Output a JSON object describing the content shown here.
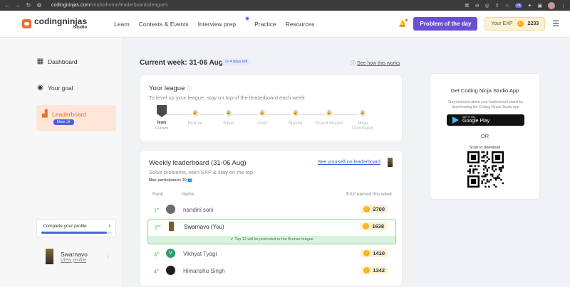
{
  "browser": {
    "url_domain": "codingninjas.com",
    "url_path": "/studio/home/leaderboards/leagues",
    "ext_badge": "28"
  },
  "brand": {
    "name": "codingninjas",
    "sub": "/studio"
  },
  "nav": {
    "items": [
      "Learn",
      "Contests & Events",
      "Interview prep",
      "Practice",
      "Resources"
    ],
    "problem_of_day": "Problem of the day",
    "exp_label": "Your EXP",
    "exp_value": "2233"
  },
  "sidebar": {
    "items": [
      {
        "label": "Dashboard",
        "icon": "dashboard-icon"
      },
      {
        "label": "Your goal",
        "icon": "target-icon"
      }
    ],
    "active": {
      "label": "Leaderboard",
      "badge": "New ✨",
      "icon": "leaderboard-icon"
    },
    "complete_profile": "Complete your profile",
    "complete_progress": 0.92,
    "user_name": "Swarnavo",
    "view_profile": "View profile"
  },
  "main": {
    "current_week": "Current week: 31-06 Aug",
    "days_left": "4 days left",
    "how_it_works": "See how this works",
    "league": {
      "title": "Your league",
      "subtitle": "To level up your league, stay on top of the leaderboard each week",
      "tiers": [
        "Iron",
        "Bronze",
        "Silver",
        "Gold",
        "Master",
        "Grand Master",
        "Ninja Dominator"
      ],
      "current_tier_note": "Current"
    },
    "weekly": {
      "title": "Weekly leaderboard (31-06 Aug)",
      "subtitle": "Solve problems, earn EXP & stay on the top.",
      "max_participants": "Max participants: 30",
      "see_yourself": "See yourself on leaderboard",
      "col_rank": "Rank",
      "col_name": "Name",
      "col_exp": "EXP earned this week",
      "promo_note": "Top 12 will be promoted to the Bronze league",
      "rows": [
        {
          "rank": "1",
          "suffix": "st",
          "name": "nandini soni",
          "exp": "2700",
          "avatar": "",
          "avatar_color": "#6b6b6b"
        },
        {
          "rank": "2",
          "suffix": "nd",
          "name": "Swarnavo (You)",
          "exp": "1638",
          "avatar": "",
          "avatar_color": "#7a5a2a"
        },
        {
          "rank": "3",
          "suffix": "rd",
          "name": "Vikhyat Tyagi",
          "exp": "1410",
          "avatar": "V",
          "avatar_color": "#2e9d6b"
        },
        {
          "rank": "4",
          "suffix": "th",
          "name": "Himanshu Singh",
          "exp": "1342",
          "avatar": "",
          "avatar_color": "#1d1d1d"
        }
      ]
    },
    "app": {
      "title": "Get Coding Ninja Studio App",
      "subtitle": "Stay informed about your leaderboard status by downloading the Coding Ninjas Studio app",
      "gp_small": "GET IT ON",
      "gp_big": "Google Play",
      "or": "OR",
      "scan": "Scan to download"
    }
  }
}
